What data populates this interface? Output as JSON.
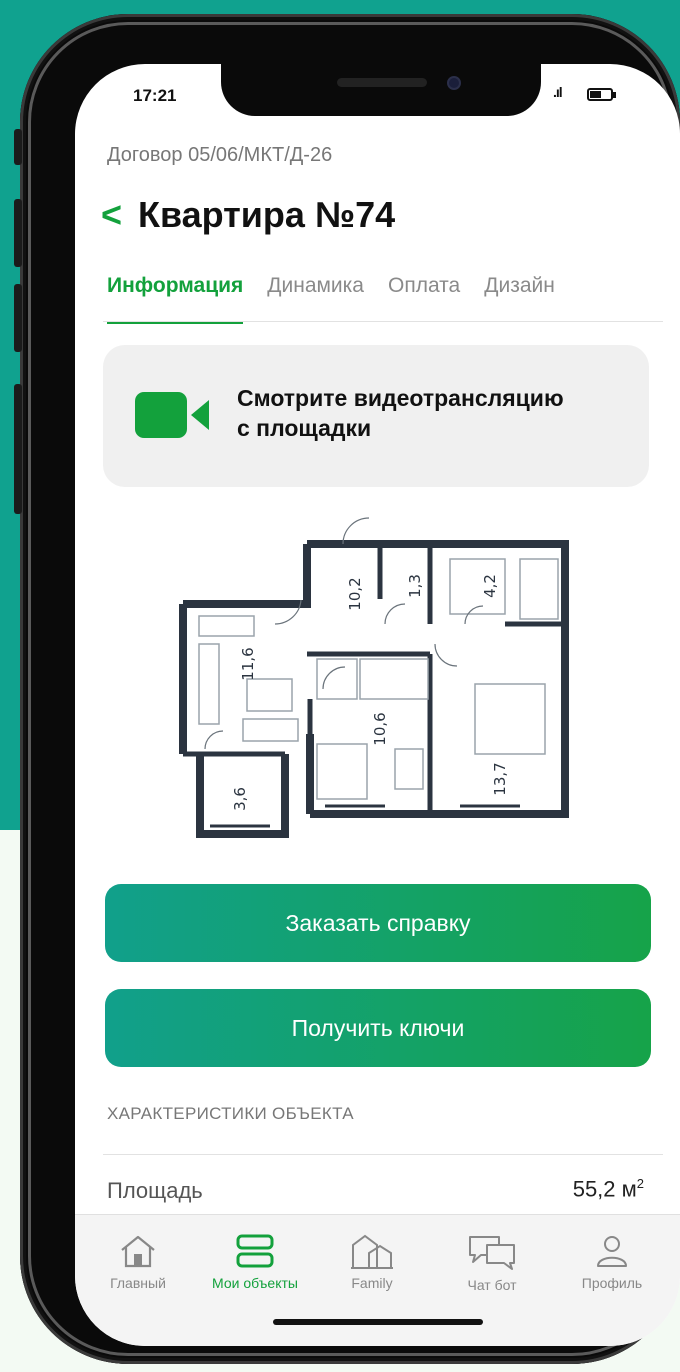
{
  "status_bar": {
    "time": "17:21",
    "signal": ".ıl"
  },
  "header": {
    "contract": "Договор 05/06/МКТ/Д-26",
    "back_glyph": "<",
    "title": "Квартира №74"
  },
  "tabs": [
    {
      "label": "Информация",
      "active": true
    },
    {
      "label": "Динамика",
      "active": false
    },
    {
      "label": "Оплата",
      "active": false
    },
    {
      "label": "Дизайн",
      "active": false
    }
  ],
  "video_card": {
    "text_line1": "Смотрите видеотрансляцию",
    "text_line2": "с площадки",
    "icon": "video-camera-icon"
  },
  "floor_plan": {
    "room_areas": [
      "11,6",
      "10,2",
      "1,3",
      "4,2",
      "10,6",
      "13,7",
      "3,6"
    ]
  },
  "buttons": {
    "order_certificate": "Заказать справку",
    "get_keys": "Получить ключи"
  },
  "characteristics": {
    "section_title": "ХАРАКТЕРИСТИКИ ОБЪЕКТА",
    "rows": [
      {
        "label": "Площадь",
        "value": "55,2 м",
        "unit_sup": "2"
      }
    ]
  },
  "bottom_nav": [
    {
      "label": "Главный",
      "icon": "home-icon",
      "active": false
    },
    {
      "label": "Мои объекты",
      "icon": "objects-icon",
      "active": true
    },
    {
      "label": "Family",
      "icon": "buildings-icon",
      "active": false
    },
    {
      "label": "Чат бот",
      "icon": "chat-icon",
      "active": false
    },
    {
      "label": "Профиль",
      "icon": "profile-icon",
      "active": false
    }
  ],
  "colors": {
    "accent": "#13a13c",
    "teal": "#10a28f",
    "background": "#f3faf3"
  }
}
